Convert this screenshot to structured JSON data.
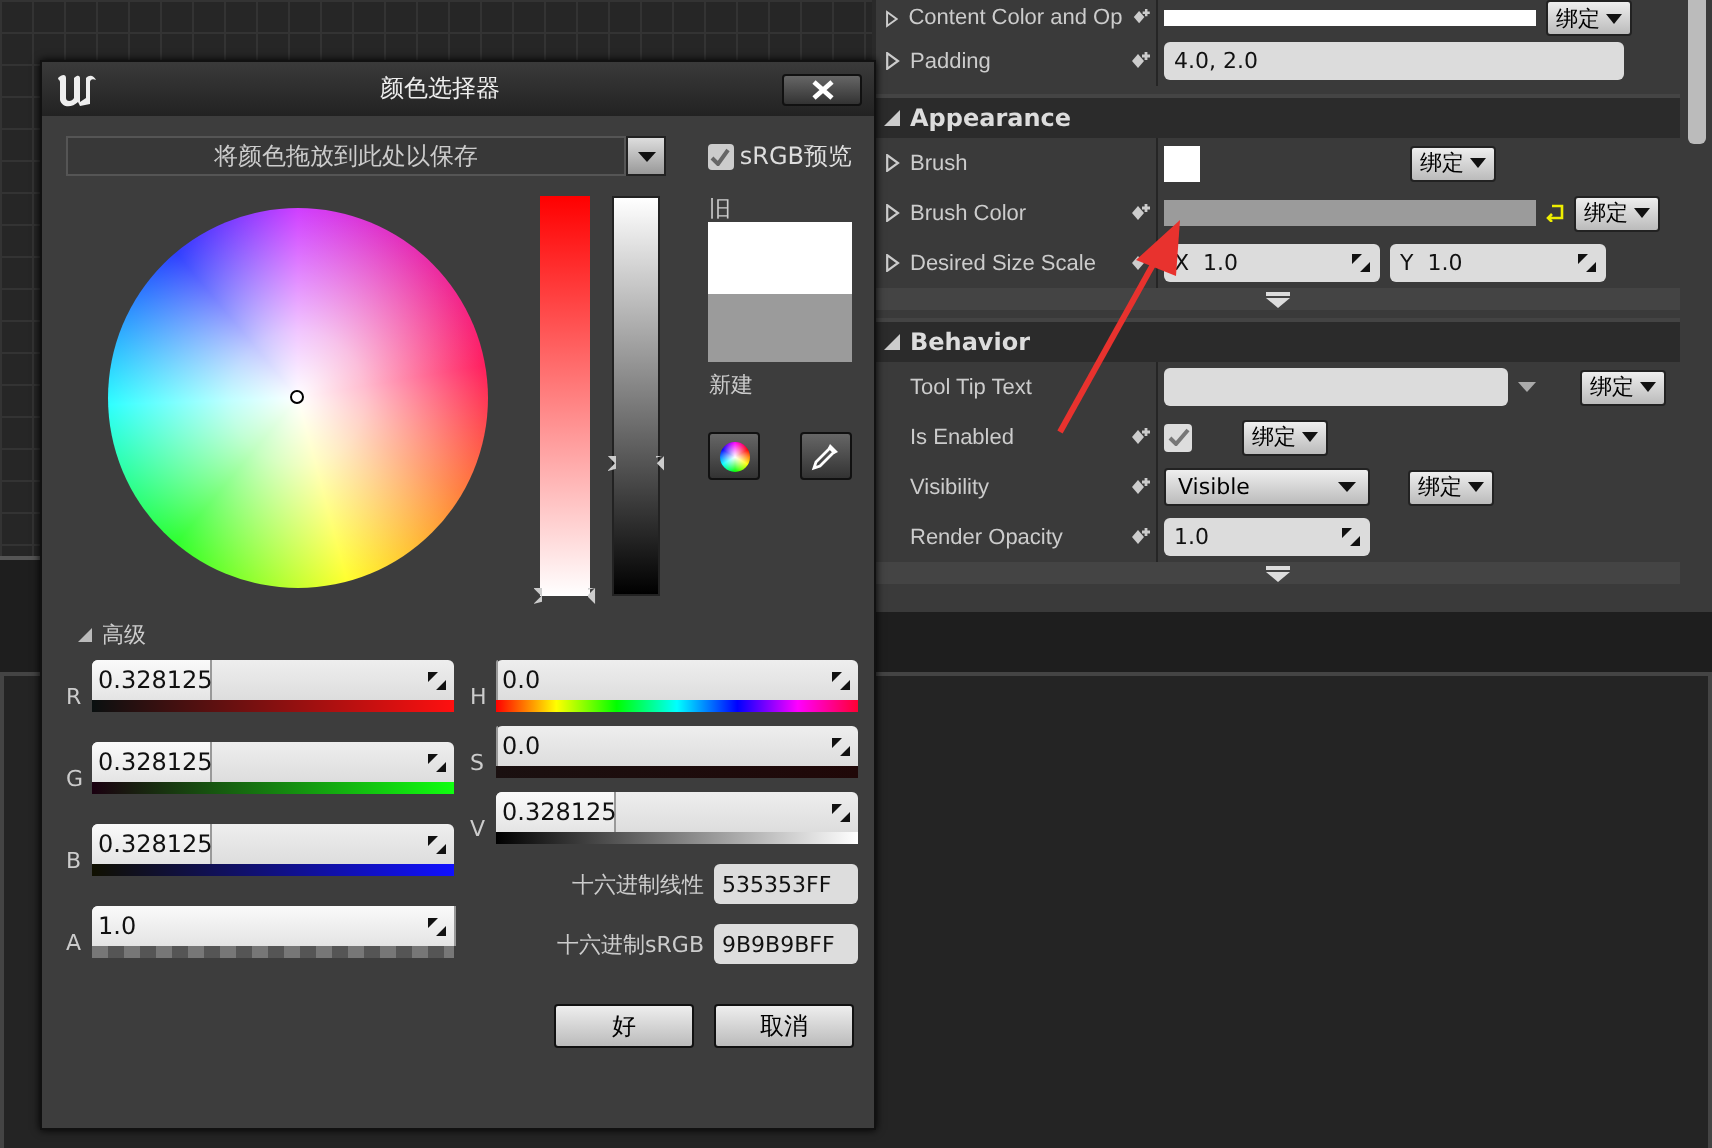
{
  "details_panel": {
    "rows": [
      {
        "name": "Content Color and Op",
        "expandable": true,
        "bindable": true,
        "kind": "color",
        "color": "#ffffff",
        "bind_button": "绑定",
        "reset": false
      },
      {
        "name": "Padding",
        "expandable": true,
        "bindable": true,
        "kind": "text",
        "value": "4.0, 2.0",
        "reset": false
      }
    ],
    "sections": [
      {
        "title": "Appearance",
        "expanded": true,
        "rows": [
          {
            "name": "Brush",
            "expandable": true,
            "bindable": false,
            "kind": "swatch",
            "color": "#ffffff",
            "bind_button": "绑定",
            "reset": false
          },
          {
            "name": "Brush Color",
            "expandable": true,
            "bindable": true,
            "kind": "color",
            "color": "#9b9b9b",
            "bind_button": "绑定",
            "reset": true
          },
          {
            "name": "Desired Size Scale",
            "expandable": true,
            "bindable": true,
            "kind": "vector",
            "x_label": "X",
            "x_value": "1.0",
            "y_label": "Y",
            "y_value": "1.0",
            "reset": false
          }
        ]
      },
      {
        "title": "Behavior",
        "expanded": true,
        "rows": [
          {
            "name": "Tool Tip Text",
            "expandable": false,
            "bindable": false,
            "kind": "combo",
            "bind_button": "绑定",
            "reset": false
          },
          {
            "name": "Is Enabled",
            "expandable": false,
            "bindable": true,
            "kind": "checkbox",
            "checked": true,
            "bind_button": "绑定",
            "reset": false
          },
          {
            "name": "Visibility",
            "expandable": false,
            "bindable": true,
            "kind": "dropdown",
            "value": "Visible",
            "bind_button": "绑定",
            "reset": false
          },
          {
            "name": "Render Opacity",
            "expandable": false,
            "bindable": true,
            "kind": "number",
            "value": "1.0",
            "reset": false
          }
        ]
      }
    ]
  },
  "color_picker": {
    "title": "颜色选择器",
    "drop_zone": "将颜色拖放到此处以保存",
    "srgb_preview": {
      "label": "sRGB预览",
      "checked": true
    },
    "saturation_bar": {
      "level": 0
    },
    "value_bar": {
      "level": 0.33
    },
    "old_label": "旧",
    "new_label": "新建",
    "advanced": {
      "label": "高级",
      "expanded": true
    },
    "rgba": [
      {
        "label": "R",
        "value": "0.328125",
        "level": 0.328,
        "kind": "red"
      },
      {
        "label": "G",
        "value": "0.328125",
        "level": 0.328,
        "kind": "green"
      },
      {
        "label": "B",
        "value": "0.328125",
        "level": 0.328,
        "kind": "blue"
      },
      {
        "label": "A",
        "value": "1.0",
        "level": 1,
        "kind": "alpha"
      }
    ],
    "hsv": [
      {
        "label": "H",
        "value": "0.0",
        "level": 0,
        "kind": "hue"
      },
      {
        "label": "S",
        "value": "0.0",
        "level": 0,
        "kind": "saturation"
      },
      {
        "label": "V",
        "value": "0.328125",
        "level": 0.328,
        "kind": "value"
      }
    ],
    "hex": [
      {
        "label": "十六进制线性",
        "value": "535353FF"
      },
      {
        "label": "十六进制sRGB",
        "value": "9B9B9BFF"
      }
    ],
    "buttons": [
      "好",
      "取消"
    ]
  }
}
